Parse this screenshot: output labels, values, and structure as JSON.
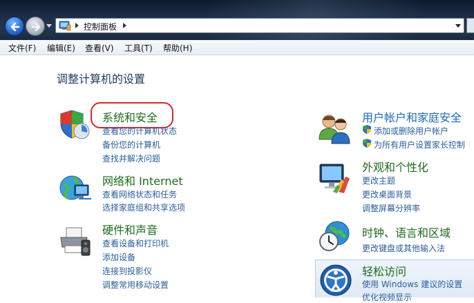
{
  "address": {
    "path": "控制面板"
  },
  "menu": [
    {
      "label": "文件(F)"
    },
    {
      "label": "编辑(E)"
    },
    {
      "label": "查看(V)"
    },
    {
      "label": "工具(T)"
    },
    {
      "label": "帮助(H)"
    }
  ],
  "page_title": "调整计算机的设置",
  "left_categories": [
    {
      "title": "系统和安全",
      "links": [
        "查看您的计算机状态",
        "备份您的计算机",
        "查找并解决问题"
      ]
    },
    {
      "title": "网络和 Internet",
      "links": [
        "查看网络状态和任务",
        "选择家庭组和共享选项"
      ]
    },
    {
      "title": "硬件和声音",
      "links": [
        "查看设备和打印机",
        "添加设备",
        "连接到投影仪",
        "调整常用移动设置"
      ]
    }
  ],
  "right_categories": [
    {
      "title": "用户帐户和家庭安全",
      "links": [
        "添加或删除用户帐户",
        "为所有用户设置家长控制"
      ]
    },
    {
      "title": "外观和个性化",
      "links": [
        "更改主题",
        "更改桌面背景",
        "调整屏幕分辨率"
      ]
    },
    {
      "title": "时钟、语言和区域",
      "links": [
        "更改键盘或其他输入法"
      ]
    },
    {
      "title": "轻松访问",
      "links": [
        "使用 Windows 建议的设置",
        "优化视频显示"
      ]
    }
  ],
  "colors": {
    "category_title": "#1c6b1c",
    "link": "#2a5d9e",
    "highlight": "#d9262b"
  }
}
